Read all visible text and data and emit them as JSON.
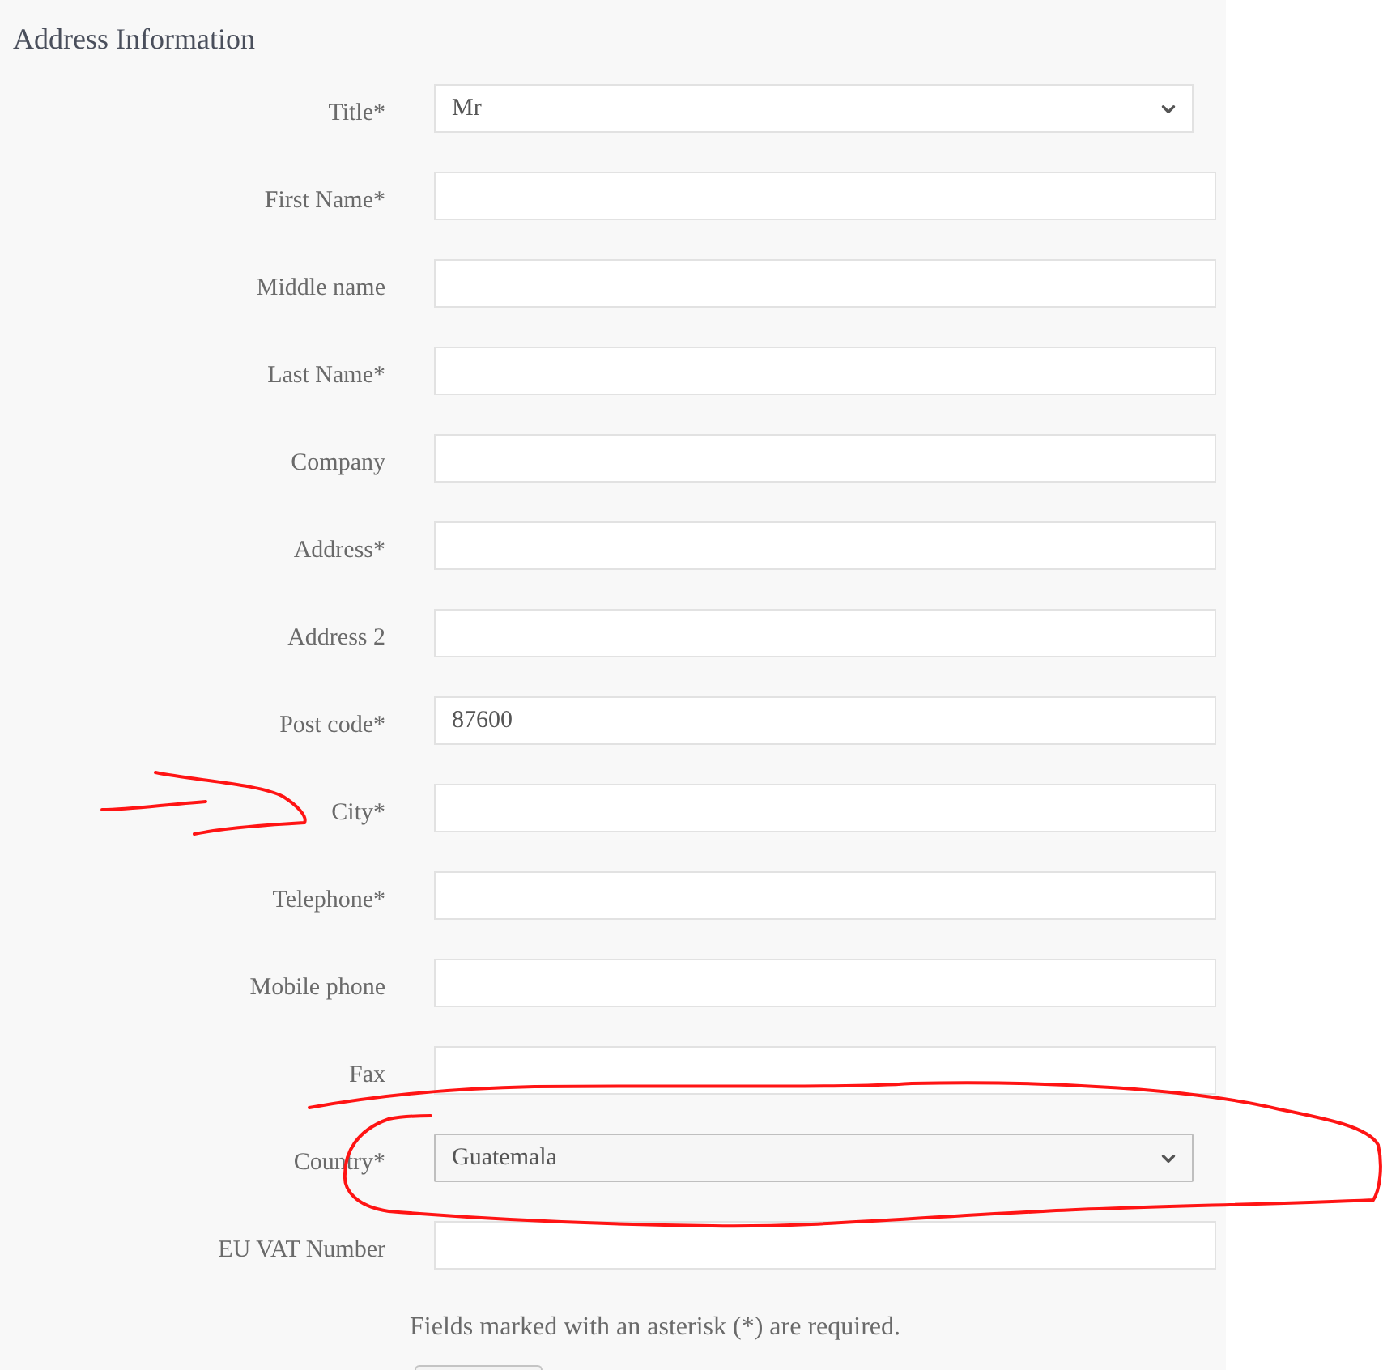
{
  "section": {
    "title": "Address Information"
  },
  "fields": [
    {
      "label": "Title*",
      "kind": "select",
      "value": "Mr"
    },
    {
      "label": "First Name*",
      "kind": "text"
    },
    {
      "label": "Middle name",
      "kind": "text"
    },
    {
      "label": "Last Name*",
      "kind": "text"
    },
    {
      "label": "Company",
      "kind": "text"
    },
    {
      "label": "Address*",
      "kind": "text"
    },
    {
      "label": "Address 2",
      "kind": "text"
    },
    {
      "label": "Post code*",
      "kind": "text",
      "value": "87600"
    },
    {
      "label": "City*",
      "kind": "text"
    },
    {
      "label": "Telephone*",
      "kind": "text"
    },
    {
      "label": "Mobile phone",
      "kind": "text"
    },
    {
      "label": "Fax",
      "kind": "text"
    },
    {
      "label": "Country*",
      "kind": "native_select",
      "value": "Guatemala"
    },
    {
      "label": "EU VAT Number",
      "kind": "text"
    }
  ],
  "note": "Fields marked with an asterisk (*) are required.",
  "actions": [
    {
      "kind": "button"
    }
  ],
  "annotations": {
    "arrow": true,
    "loop": true
  }
}
